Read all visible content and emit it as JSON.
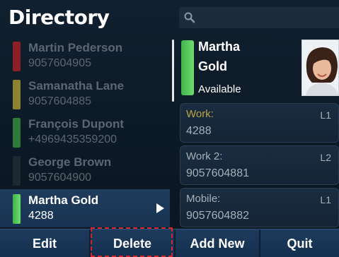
{
  "header": {
    "title": "Directory"
  },
  "search": {
    "icon": "search-icon",
    "value": ""
  },
  "contacts": [
    {
      "name": "Martin Pederson",
      "number": "9057604905",
      "status_color": "#c3282f"
    },
    {
      "name": "Samanatha Lane",
      "number": "9057604885",
      "status_color": "#c9b838"
    },
    {
      "name": "François Dupont",
      "number": "+4969435359200",
      "status_color": "#3fa648"
    },
    {
      "name": "George Brown",
      "number": "9057604900",
      "status_color": "#2a3440"
    },
    {
      "name": "Martha Gold",
      "number": "4288",
      "status_color": "#4fc84f",
      "selected": true
    }
  ],
  "detail": {
    "first_name": "Martha",
    "last_name": "Gold",
    "status": "Available",
    "status_color": "#4fc84f",
    "fields": [
      {
        "label": "Work:",
        "value": "4288",
        "line": "L1"
      },
      {
        "label": "Work 2:",
        "value": "9057604881",
        "line": "L2"
      },
      {
        "label": "Mobile:",
        "value": "9057604882",
        "line": "L1"
      }
    ]
  },
  "softkeys": {
    "edit": "Edit",
    "delete": "Delete",
    "add_new": "Add New",
    "quit": "Quit"
  },
  "colors": {
    "highlight": "#d8252b",
    "selected_row": "#1f3c5c"
  }
}
